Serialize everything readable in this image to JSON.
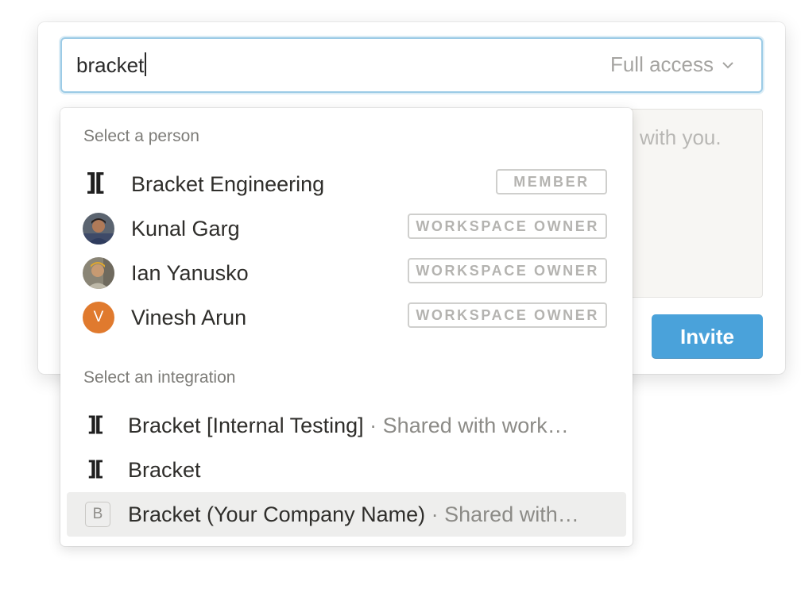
{
  "search": {
    "value": "bracket"
  },
  "access_dropdown": {
    "label": "Full access"
  },
  "message": {
    "visible_text": "with you."
  },
  "invite_button": {
    "label": "Invite"
  },
  "dropdown": {
    "people_section_label": "Select a person",
    "people": [
      {
        "name": "Bracket Engineering",
        "role": "MEMBER",
        "icon": "bracket-logo-icon"
      },
      {
        "name": "Kunal Garg",
        "role": "WORKSPACE OWNER",
        "icon": "avatar-photo"
      },
      {
        "name": "Ian Yanusko",
        "role": "WORKSPACE OWNER",
        "icon": "avatar-photo"
      },
      {
        "name": "Vinesh Arun",
        "role": "WORKSPACE OWNER",
        "icon": "avatar-initial",
        "initial": "V",
        "color": "#e07a2e"
      }
    ],
    "integrations_section_label": "Select an integration",
    "integrations": [
      {
        "name": "Bracket [Internal Testing]",
        "sub": " · Shared with work…",
        "icon": "bracket-logo-icon"
      },
      {
        "name": "Bracket",
        "sub": "",
        "icon": "bracket-logo-icon"
      },
      {
        "name": "Bracket (Your Company Name)",
        "sub": " · Shared with…",
        "icon": "letter-b-icon",
        "letter": "B"
      }
    ]
  },
  "colors": {
    "accent": "#4aa2da",
    "focus_ring": "#9ccbe6",
    "hover_row": "#eeeeed"
  }
}
